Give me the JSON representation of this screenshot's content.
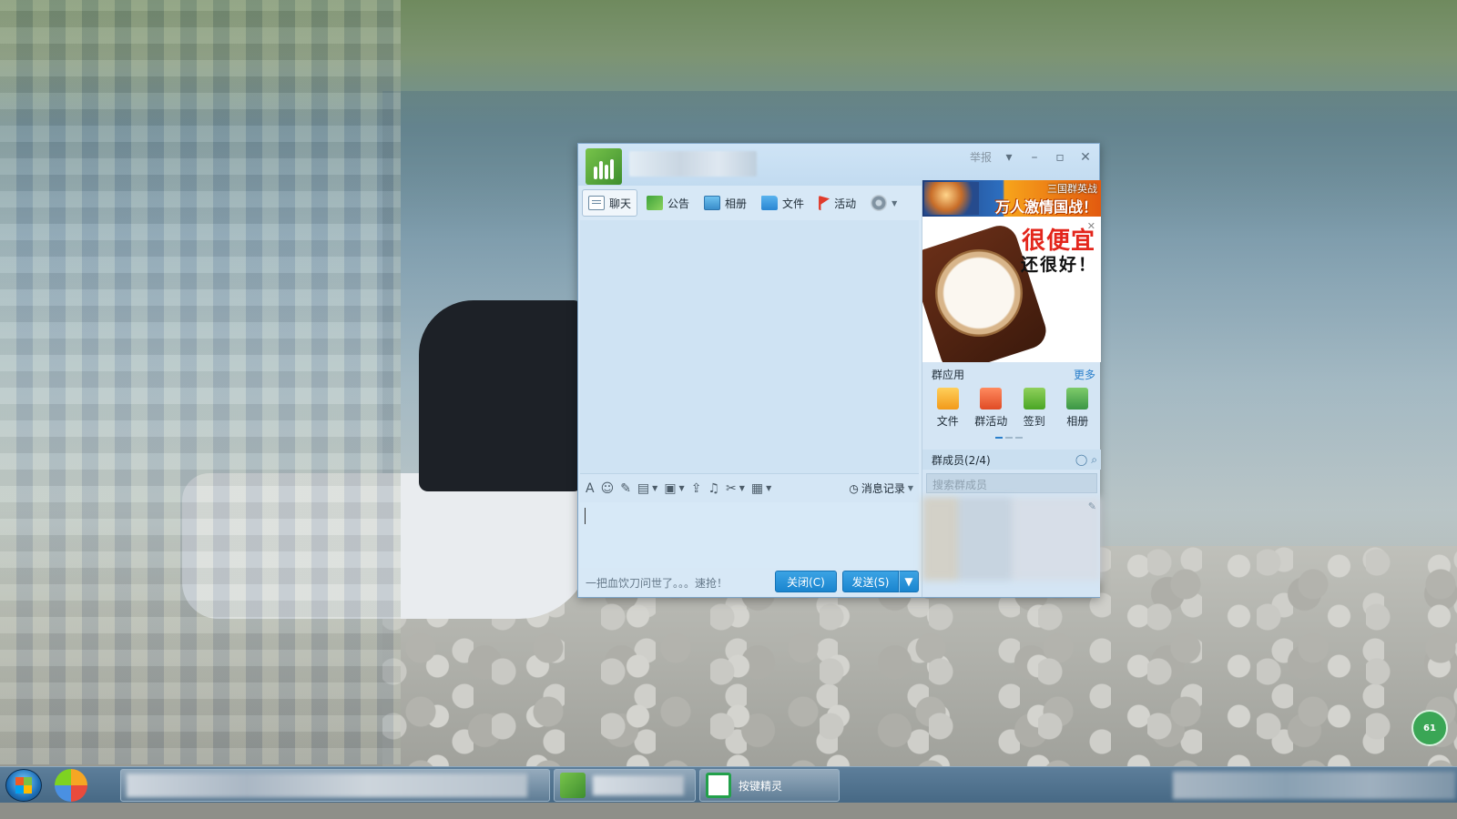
{
  "window": {
    "report_label": "举报",
    "tabs": [
      {
        "label": "聊天",
        "icon": "chat-icon"
      },
      {
        "label": "公告",
        "icon": "notice-flag-icon"
      },
      {
        "label": "相册",
        "icon": "album-icon"
      },
      {
        "label": "文件",
        "icon": "folder-icon"
      },
      {
        "label": "活动",
        "icon": "activity-flag-icon"
      }
    ],
    "input_toolbar": {
      "history_label": "消息记录"
    },
    "bottom": {
      "ad_text": "一把血饮刀问世了。。。速抢！",
      "close_label": "关闭(C)",
      "send_label": "发送(S)"
    }
  },
  "right_panel": {
    "ad_banner": {
      "small": "三国群英战",
      "big": "万人激情国战！"
    },
    "ad_watch": {
      "line1": "很便宜",
      "line2": "还很好！"
    },
    "apps_title": "群应用",
    "apps_more": "更多",
    "apps": [
      {
        "label": "文件",
        "icon": "folder-app-icon"
      },
      {
        "label": "群活动",
        "icon": "group-activity-icon"
      },
      {
        "label": "签到",
        "icon": "checkin-icon"
      },
      {
        "label": "相册",
        "icon": "album-app-icon"
      }
    ],
    "members_title": "群成员(2/4)",
    "member_search_placeholder": "搜索群成员"
  },
  "taskbar": {
    "task3_label": "按键精灵"
  },
  "tray_badge": "61",
  "colors": {
    "accent_blue": "#1a85cf",
    "window_bg": "#d7e8f6",
    "ad_red": "#e3261c"
  }
}
